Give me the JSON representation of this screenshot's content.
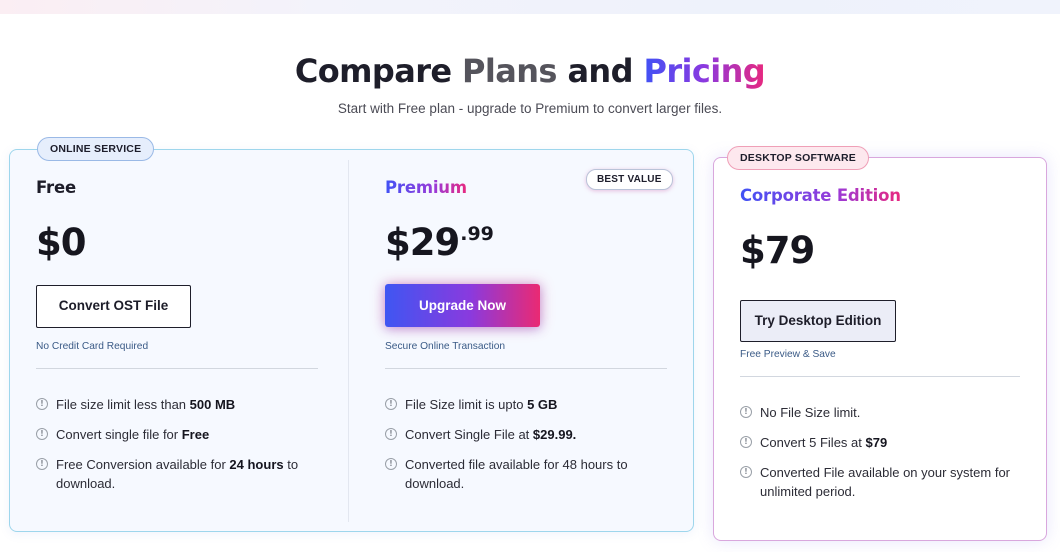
{
  "header": {
    "title_w1": "Compare",
    "title_w2": "Plans",
    "title_w3": "and",
    "title_w4": "Pricing",
    "subtitle": "Start with Free plan - upgrade to Premium to convert larger files."
  },
  "online_card": {
    "tag": "ONLINE SERVICE",
    "free": {
      "name": "Free",
      "price": "$0",
      "button": "Convert OST File",
      "note": "No Credit Card Required",
      "features": [
        {
          "pre": "File size limit less than ",
          "bold": "500 MB",
          "post": ""
        },
        {
          "pre": "Convert single file for ",
          "bold": "Free",
          "post": ""
        },
        {
          "pre": "Free Conversion available for ",
          "bold": "24 hours",
          "post": " to download."
        }
      ]
    },
    "premium": {
      "name": "Premium",
      "badge": "BEST VALUE",
      "price_main": "$29",
      "price_cents": ".99",
      "button": "Upgrade Now",
      "note": "Secure Online Transaction",
      "features": [
        {
          "pre": "File Size limit is upto ",
          "bold": "5 GB",
          "post": ""
        },
        {
          "pre": "Convert Single File at ",
          "bold": "$29.99.",
          "post": ""
        },
        {
          "pre": "Converted file available for 48 hours to download.",
          "bold": "",
          "post": ""
        }
      ]
    }
  },
  "desktop_card": {
    "tag": "DESKTOP SOFTWARE",
    "name": "Corporate Edition",
    "price": "$79",
    "button": "Try Desktop Edition",
    "note": "Free Preview & Save",
    "features": [
      {
        "pre": "No File Size limit.",
        "bold": "",
        "post": ""
      },
      {
        "pre": "Convert 5 Files at ",
        "bold": "$79",
        "post": ""
      },
      {
        "pre": "Converted File available on your system for unlimited period.",
        "bold": "",
        "post": ""
      }
    ]
  },
  "icons": {
    "feature_bullet": "info-circle-icon",
    "info_glyph": "!"
  },
  "colors": {
    "accent_blue": "#4052f5",
    "accent_purple": "#8a39e0",
    "accent_pink": "#e8287e",
    "online_border": "#9ed6ec",
    "desktop_border": "#d9a7dd"
  }
}
